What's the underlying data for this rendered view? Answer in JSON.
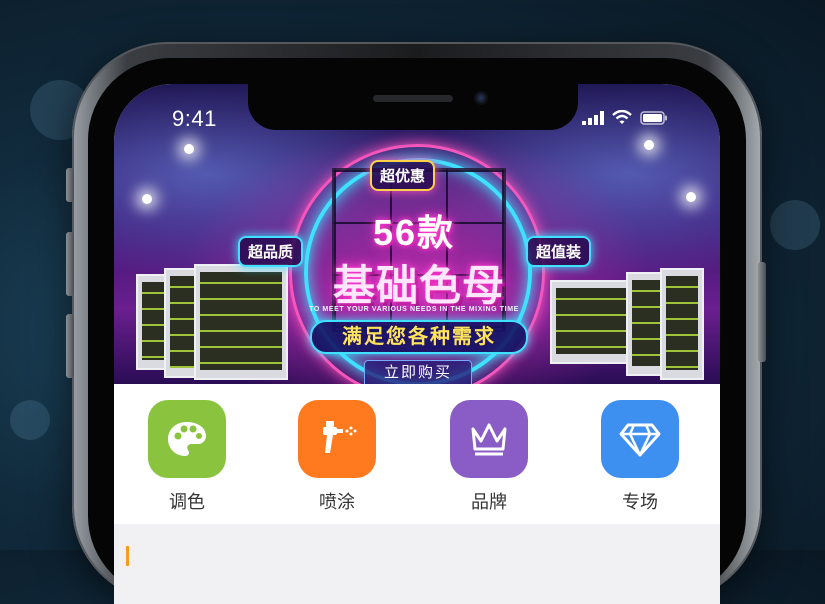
{
  "status_bar": {
    "time": "9:41"
  },
  "banner": {
    "top_tag": "超优惠",
    "left_tag": "超品质",
    "right_tag": "超值装",
    "headline_count": "56款",
    "headline_main": "基础色母",
    "subtitle_en": "TO MEET YOUR VARIOUS NEEDS IN THE MIXING TIME",
    "slogan": "满足您各种需求",
    "buy_label": "立即购买"
  },
  "menu": {
    "items": [
      {
        "label": "调色",
        "icon": "palette-icon",
        "color": "#8ac43f"
      },
      {
        "label": "喷涂",
        "icon": "spray-gun-icon",
        "color": "#ff7a1f"
      },
      {
        "label": "品牌",
        "icon": "crown-icon",
        "color": "#8a5cc6"
      },
      {
        "label": "专场",
        "icon": "diamond-icon",
        "color": "#3d8ff0"
      }
    ]
  },
  "section": {
    "title": ""
  },
  "colors": {
    "accent": "#ff9a1f",
    "neon_cyan": "#40e0ff",
    "neon_pink": "#ff3ad0"
  }
}
